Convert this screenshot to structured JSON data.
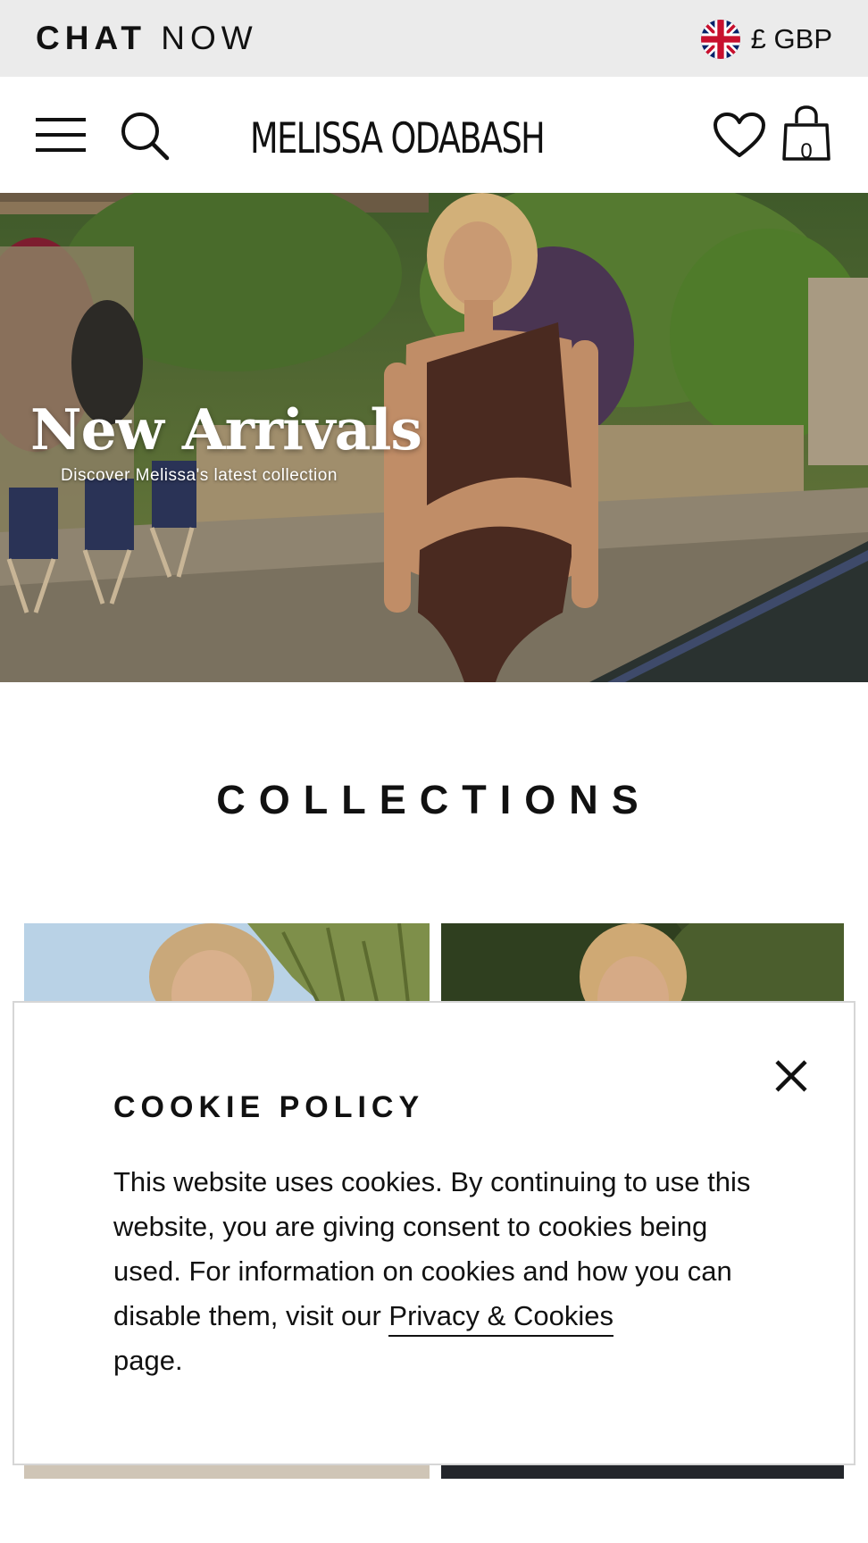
{
  "topbar": {
    "chat_bold": "CHAT",
    "chat_regular": "NOW",
    "currency_label": "£ GBP",
    "flag_icon": "uk-flag-icon"
  },
  "header": {
    "brand": "MELISSA ODABASH",
    "bag_count": "0",
    "icons": [
      "menu-icon",
      "search-icon",
      "heart-icon",
      "shopping-bag-icon"
    ]
  },
  "hero": {
    "title": "New Arrivals",
    "subtitle": "Discover Melissa's latest collection"
  },
  "collections": {
    "title": "COLLECTIONS"
  },
  "cookie": {
    "title": "COOKIE POLICY",
    "body_part1": "This website uses cookies. By continuing to use this website, you are giving consent to cookies being used. For information on cookies and how you can disable them, visit our ",
    "link_text": "Privacy & Cookies",
    "body_part2": " page.",
    "close_icon": "close-icon"
  },
  "colors": {
    "topbar_bg": "#ebebeb",
    "text": "#111111",
    "modal_border": "#d6d6d6"
  }
}
